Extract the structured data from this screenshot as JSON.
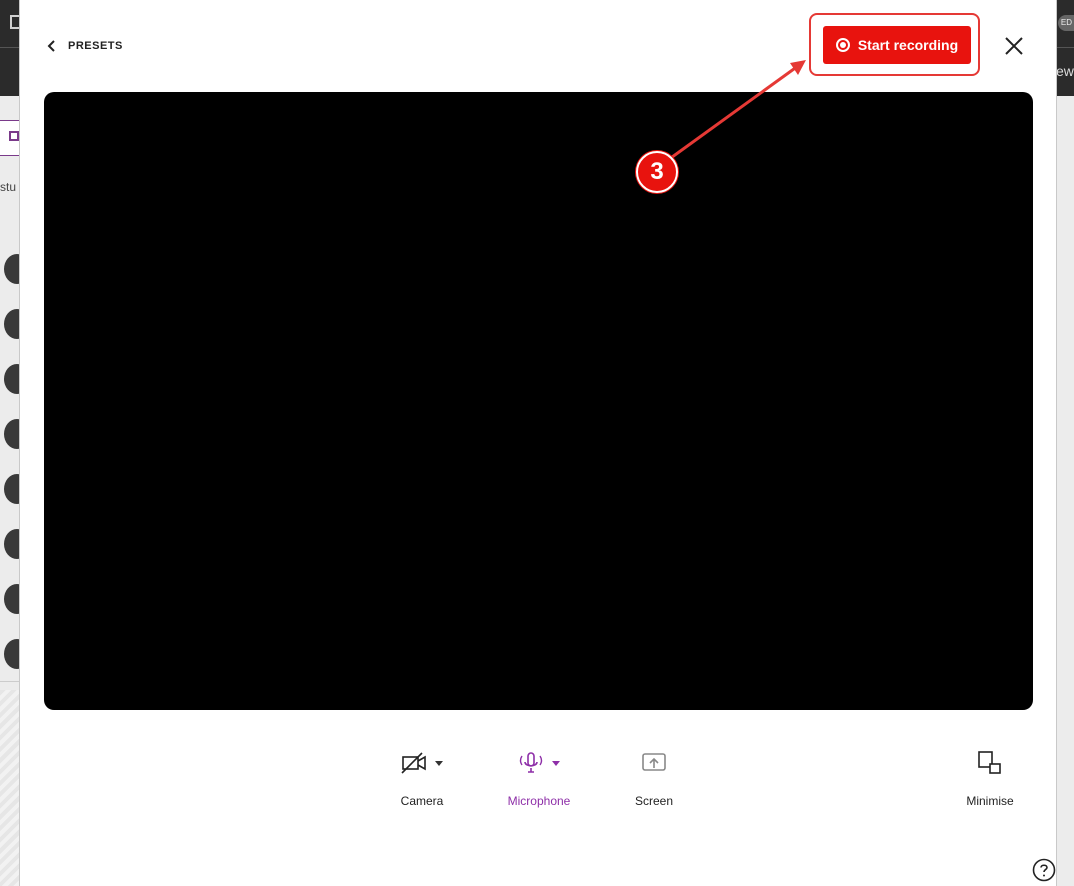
{
  "app": {
    "background_partial_left": "stu",
    "background_partial_right": "ew",
    "background_partial_badge": "ED"
  },
  "header": {
    "back_label": "PRESETS",
    "record_label": "Start recording"
  },
  "controls": [
    {
      "label": "Camera",
      "icon": "camera-off-icon"
    },
    {
      "label": "Microphone",
      "icon": "microphone-icon"
    },
    {
      "label": "Screen",
      "icon": "screen-share-icon"
    },
    {
      "label": "Minimise",
      "icon": "minimise-icon"
    }
  ],
  "annotation": {
    "step_number": "3"
  },
  "colors": {
    "record_red": "#e8130e",
    "accent_purple": "#8e2fa8",
    "preview_black": "#000000"
  }
}
